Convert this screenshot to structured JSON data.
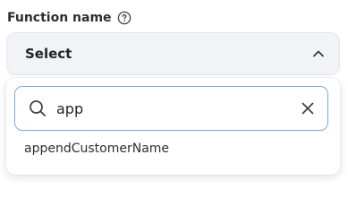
{
  "field": {
    "label": "Function name",
    "help_icon": "question-circle-icon"
  },
  "select": {
    "value": "Select",
    "chevron_icon": "chevron-up-icon"
  },
  "search": {
    "value": "app",
    "search_icon": "search-icon",
    "clear_icon": "close-icon"
  },
  "options": [
    {
      "label": "appendCustomerName"
    }
  ],
  "colors": {
    "select_background": "#f1f3f6",
    "focus_border": "#7fa6e6",
    "text": "#1f2328"
  }
}
